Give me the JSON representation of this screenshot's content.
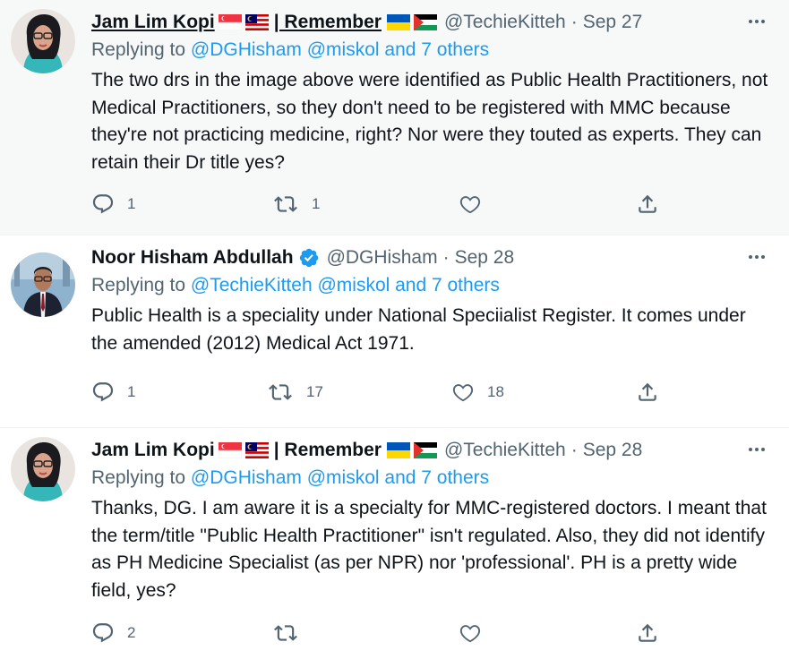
{
  "tweets": [
    {
      "author_name": "Jam Lim Kopi",
      "author_suffix": "| Remember",
      "handle": "@TechieKitteh",
      "date": "Sep 27",
      "replying_prefix": "Replying to",
      "replying_links": "@DGHisham @miskol and 7 others",
      "text": "The two drs in the image above were identified as Public Health Practitioners, not Medical Practitioners, so they don't need to be registered with MMC because they're not practicing medicine, right? Nor were they touted as experts. They can retain their Dr title yes?",
      "reply_count": "1",
      "retweet_count": "1",
      "like_count": ""
    },
    {
      "author_name": "Noor Hisham Abdullah",
      "handle": "@DGHisham",
      "date": "Sep 28",
      "replying_prefix": "Replying to",
      "replying_links": "@TechieKitteh @miskol and 7 others",
      "text": "Public Health is a speciality under National Speciialist Register. It comes under the amended (2012) Medical Act 1971.",
      "reply_count": "1",
      "retweet_count": "17",
      "like_count": "18"
    },
    {
      "author_name": "Jam Lim Kopi",
      "author_suffix": "| Remember",
      "handle": "@TechieKitteh",
      "date": "Sep 28",
      "replying_prefix": "Replying to",
      "replying_links": "@DGHisham @miskol and 7 others",
      "text": "Thanks, DG. I am aware it is a specialty for MMC-registered doctors. I meant that the term/title \"Public Health Practitioner\" isn't regulated. Also, they did not identify as PH Medicine Specialist (as per NPR) nor 'professional'. PH is a pretty wide field, yes?",
      "reply_count": "2",
      "retweet_count": "",
      "like_count": ""
    }
  ],
  "separator": "·",
  "icons": {
    "reply": "reply-icon",
    "retweet": "retweet-icon",
    "like": "heart-icon",
    "share": "share-icon",
    "more": "more-icon",
    "verified": "verified-badge-icon",
    "flags": [
      "singapore-flag-icon",
      "malaysia-flag-icon",
      "ukraine-flag-icon",
      "palestine-flag-icon"
    ]
  },
  "colors": {
    "link": "#1d9bf0",
    "secondary_text": "#536471",
    "highlight_background": "#f7f9f9",
    "verified": "#1d9bf0"
  }
}
